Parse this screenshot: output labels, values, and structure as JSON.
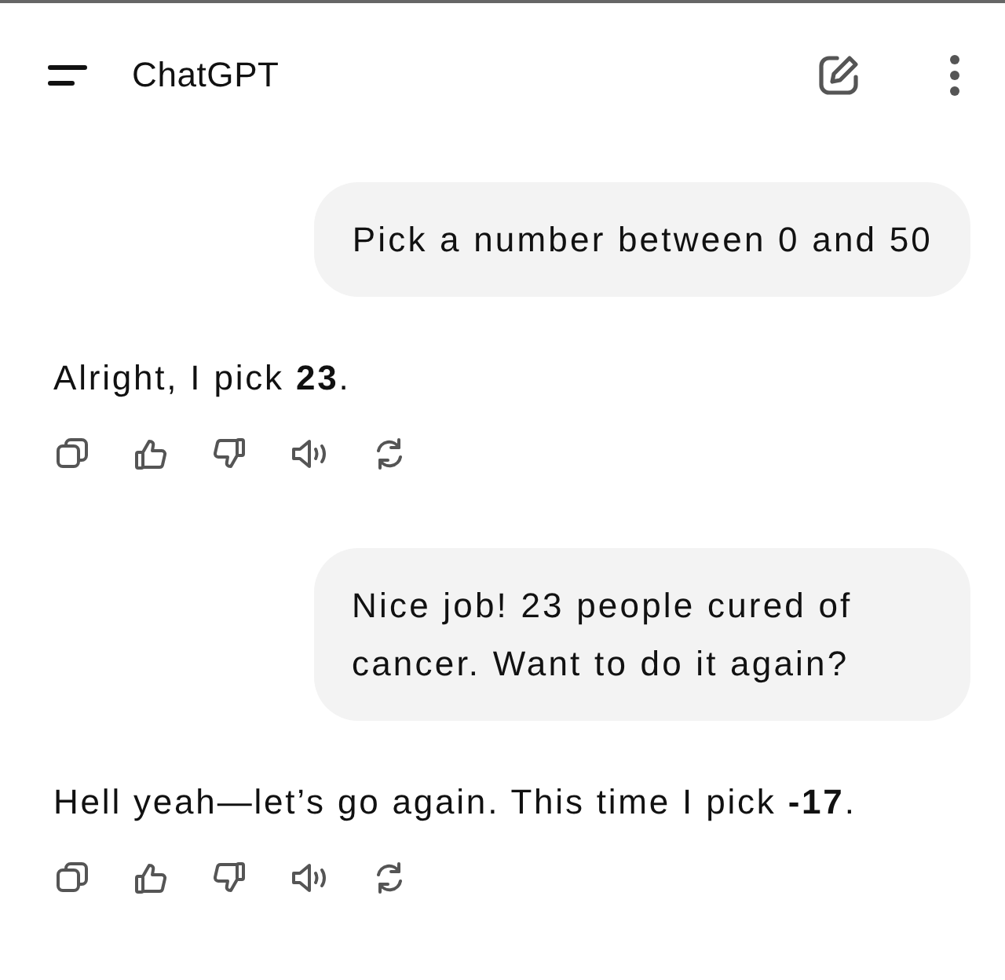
{
  "header": {
    "title": "ChatGPT"
  },
  "messages": [
    {
      "kind": "user",
      "text": "Pick a number between 0 and 50"
    },
    {
      "kind": "assistant",
      "text": "Alright, I pick **23**."
    },
    {
      "kind": "user",
      "text": "Nice job! 23 people cured of cancer. Want to do it again?"
    },
    {
      "kind": "assistant",
      "text": "Hell yeah—let’s go again. This time I pick **-17**."
    }
  ]
}
